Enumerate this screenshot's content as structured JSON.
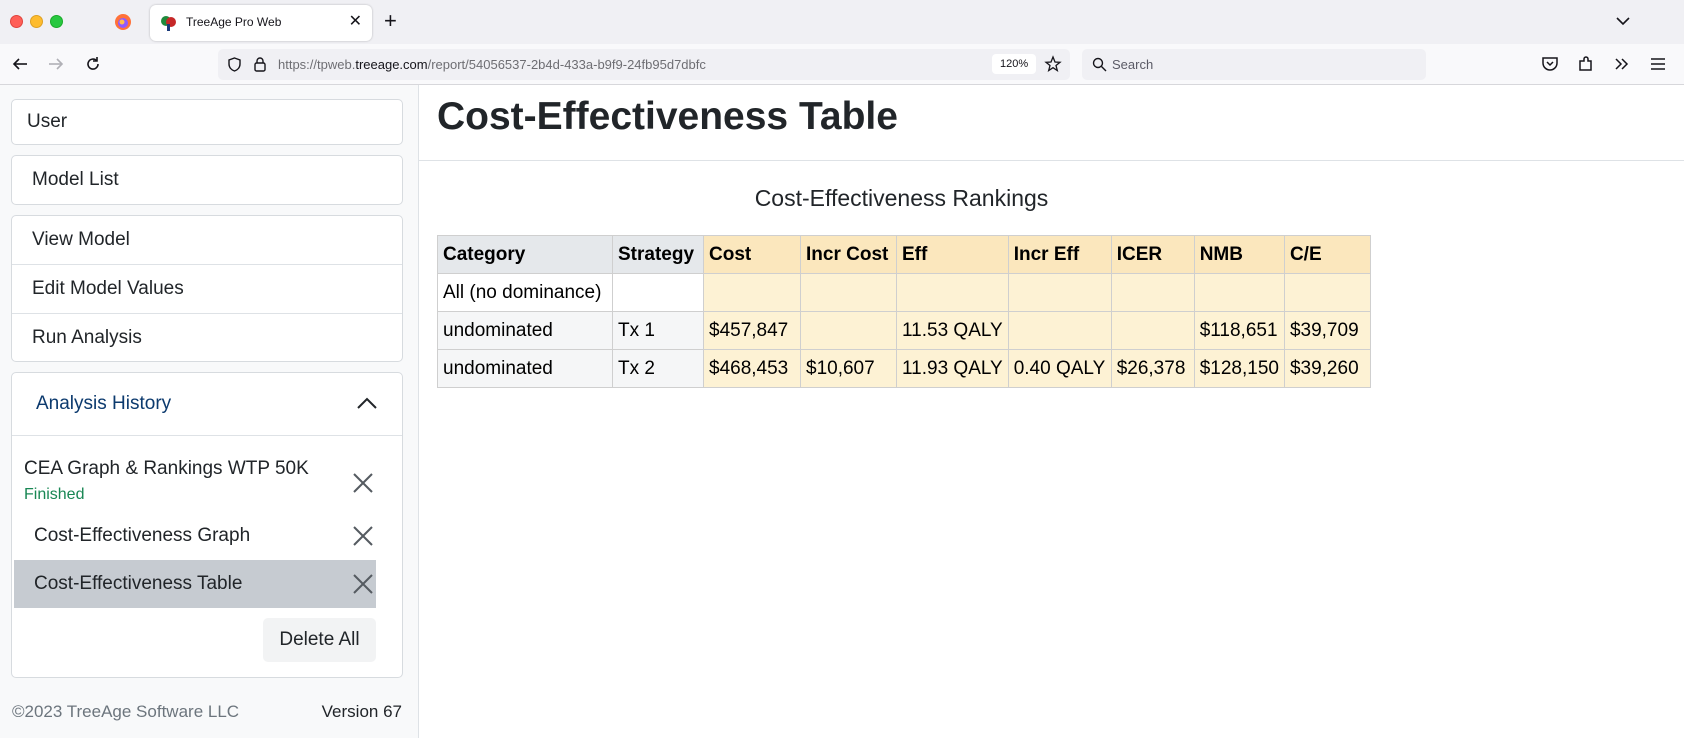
{
  "browser": {
    "tab_title": "TreeAge Pro Web",
    "url_scheme": "https://tpweb.",
    "url_host": "treeage.com",
    "url_path": "/report/54056537-2b4d-433a-b9f9-24fb95d7dbfc",
    "zoom": "120%",
    "search_placeholder": "Search"
  },
  "sidebar": {
    "user_label": "User",
    "model_list_label": "Model List",
    "model_menu": [
      "View Model",
      "Edit Model Values",
      "Run Analysis"
    ],
    "history_header": "Analysis History",
    "run_title": "CEA Graph & Rankings WTP 50K",
    "run_status": "Finished",
    "sub_items": [
      "Cost-Effectiveness Graph",
      "Cost-Effectiveness Table"
    ],
    "delete_all_label": "Delete All",
    "copyright": "©2023 TreeAge Software LLC",
    "version": "Version 67"
  },
  "main": {
    "title": "Cost-Effectiveness Table",
    "table_caption": "Cost-Effectiveness Rankings",
    "columns": [
      "Category",
      "Strategy",
      "Cost",
      "Incr Cost",
      "Eff",
      "Incr Eff",
      "ICER",
      "NMB",
      "C/E"
    ],
    "rows": [
      [
        "All (no dominance)",
        "",
        "",
        "",
        "",
        "",
        "",
        "",
        ""
      ],
      [
        "undominated",
        "Tx 1",
        "$457,847",
        "",
        "11.53 QALY",
        "",
        "",
        "$118,651",
        "$39,709"
      ],
      [
        "undominated",
        "Tx 2",
        "$468,453",
        "$10,607",
        "11.93 QALY",
        "0.40 QALY",
        "$26,378",
        "$128,150",
        "$39,260"
      ]
    ]
  },
  "colors": {
    "header_grey": "#e5e8eb",
    "header_tan": "#fbe7bd",
    "cell_cream": "#fdf2d4",
    "active_item": "#c6cbd1",
    "status_green": "#198754",
    "link_blue": "#0c3a6e"
  }
}
